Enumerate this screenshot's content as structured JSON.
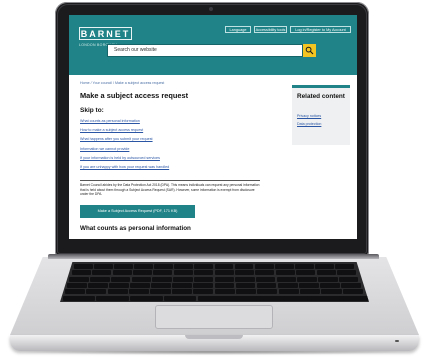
{
  "header": {
    "logo_text": "BARNET",
    "logo_subtext": "LONDON BOROUGH",
    "buttons": [
      "Language",
      "Accessibility tools",
      "Log in/Register to My Account"
    ],
    "search_placeholder": "Search our website",
    "brand_color": "#1f8387",
    "search_button_color": "#f4c521"
  },
  "main": {
    "breadcrumb": "Home / Your council / Make a subject access request",
    "title": "Make a subject access request",
    "skip_heading": "Skip to:",
    "skip_links": [
      "What counts as personal information",
      "How to make a subject access request",
      "What happens after you submit your request",
      "Information we cannot provide",
      "If your information is held by outsourced services",
      "If you are unhappy with how your request was handled"
    ],
    "body_text": "Barnet Council abides by the Data Protection Act 2018 (DPA). This means individuals can request any personal information that is held about them through a Subject Access Request (SAR). However, some information is exempt from disclosure under the DPA.",
    "cta_label": "Make a Subject Access Request (PDF, 171 KB)",
    "section_heading": "What counts as personal information"
  },
  "related": {
    "heading": "Related content",
    "links": [
      "Privacy notices",
      "Data protection"
    ]
  }
}
